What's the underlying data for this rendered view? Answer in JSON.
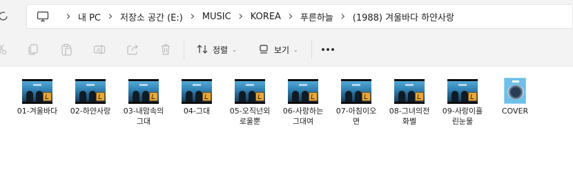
{
  "address": {
    "icons": {
      "refresh": "refresh-icon",
      "pc": "computer-icon"
    },
    "breadcrumbs": [
      "내 PC",
      "저장소 공간 (E:)",
      "MUSIC",
      "KOREA",
      "푸른하늘",
      "(1988) 겨울바다 하얀사랑"
    ]
  },
  "toolbar": {
    "icons": [
      "cut-icon",
      "copy-icon",
      "paste-icon",
      "rename-icon",
      "share-icon",
      "delete-icon"
    ],
    "sort_label": "정렬",
    "view_label": "보기"
  },
  "files": [
    {
      "name": "01-겨울바다",
      "type": "audio"
    },
    {
      "name": "02-하얀사랑",
      "type": "audio"
    },
    {
      "name": "03-내맘속의그대",
      "type": "audio"
    },
    {
      "name": "04-그대",
      "type": "audio"
    },
    {
      "name": "05-오직넌외로울뿐",
      "type": "audio"
    },
    {
      "name": "06-사랑하는그대여",
      "type": "audio"
    },
    {
      "name": "07-아침이오면",
      "type": "audio"
    },
    {
      "name": "08-그녀의전화벨",
      "type": "audio"
    },
    {
      "name": "09-사랑이흘린눈물",
      "type": "audio"
    },
    {
      "name": "COVER",
      "type": "image"
    }
  ],
  "colors": {
    "accent": "#0067c0",
    "window_bg": "#f3f3f3",
    "content_bg": "#ffffff"
  }
}
